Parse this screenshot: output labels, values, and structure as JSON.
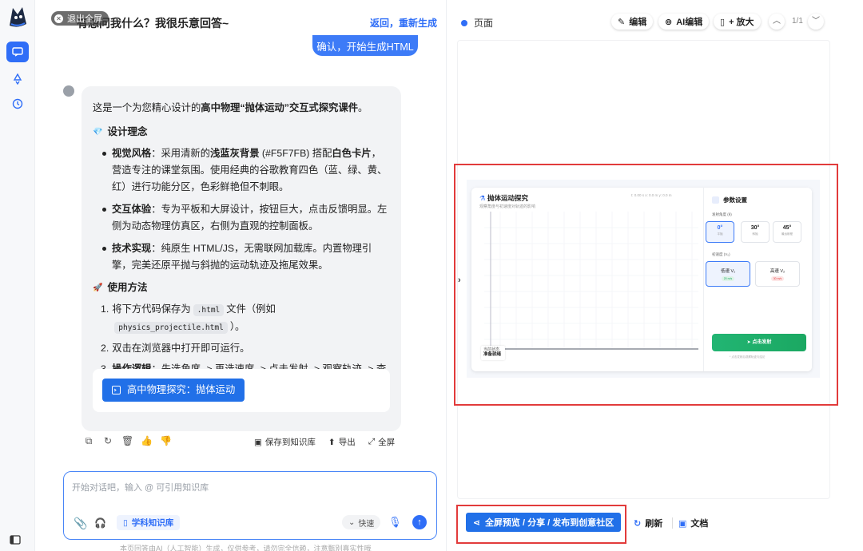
{
  "exit_fullscreen": "退出全屏",
  "chat": {
    "title": "有想问我什么？我很乐意回答~",
    "regenerate": "返回，重新生成",
    "user_message": "确认，开始生成HTML",
    "answer": {
      "intro_plain": "这是一个为您精心设计的",
      "intro_bold": "高中物理“抛体运动”交互式探究课件",
      "intro_end": "。",
      "design_heading": "设计理念",
      "design_icon": "💎",
      "bullets": [
        {
          "label": "视觉风格",
          "text_a": "：采用清新的",
          "bold_a": "浅蓝灰背景",
          "text_b": " (#F5F7FB) 搭配",
          "bold_b": "白色卡片",
          "text_c": "，营造专注的课堂氛围。使用经典的谷歌教育四色（蓝、绿、黄、红）进行功能分区，色彩鲜艳但不刺眼。"
        },
        {
          "label": "交互体验",
          "text": "：专为平板和大屏设计，按钮巨大，点击反馈明显。左侧为动态物理仿真区，右侧为直观的控制面板。"
        },
        {
          "label": "技术实现",
          "text": "：纯原生 HTML/JS，无需联网加载库。内置物理引擎，完美还原平抛与斜抛的运动轨迹及拖尾效果。"
        }
      ],
      "usage_heading": "使用方法",
      "usage_icon": "🚀",
      "steps": [
        {
          "num": "1.",
          "text_a": "将下方代码保存为",
          "code_a": ".html",
          "text_b": "文件（例如",
          "code_b": "physics_projectile.html",
          "text_c": "）。"
        },
        {
          "num": "2.",
          "text": "双击在浏览器中打开即可运行。"
        },
        {
          "num": "3.",
          "label": "操作逻辑",
          "text": "：先选角度 -> 再选速度 -> 点击发射 -> 观察轨迹 -> 查看结论。"
        }
      ],
      "artifact_label": "高中物理探究：抛体运动"
    },
    "actions": {
      "save_kb": "保存到知识库",
      "export": "导出",
      "fullscreen": "全屏"
    },
    "input": {
      "placeholder": "开始对话吧，输入 @ 可引用知识库",
      "kb_chip": "学科知识库",
      "speed": "快速"
    },
    "disclaimer": "本页回答由AI（人工智能）生成，仅供参考，请勿完全信赖，注意甄别真实性哦"
  },
  "preview_panel": {
    "title": "页面",
    "edit": "编辑",
    "ai_edit": "AI编辑",
    "zoom": "+ 放大",
    "page_count": "1/1",
    "app": {
      "title": "抛体运动探究",
      "subtitle": "观察角度与初速度对轨迹的影响",
      "meta": "t: 0.00 s   x: 0.0 m   y: 0.0 m",
      "status_label": "当前状态",
      "status_value": "准备就绪",
      "panel_title": "参数设置",
      "angle_label": "发射角度 (θ)",
      "angles": [
        {
          "value": "0°",
          "sub": "平抛",
          "selected": true
        },
        {
          "value": "30°",
          "sub": "斜抛",
          "selected": false
        },
        {
          "value": "45°",
          "sub": "最远射程",
          "selected": false
        }
      ],
      "speed_label": "初速度 (V₀)",
      "speeds": [
        {
          "name": "低速 V₁",
          "tag": "20 m/s",
          "selected": true
        },
        {
          "name": "高速 V₂",
          "tag": "30 m/s",
          "selected": false
        }
      ],
      "fire": "点击发射",
      "hint": "* 点击发射后观察轨迹与结论"
    },
    "bottom": {
      "share": "全屏预览 / 分享 / 发布到创意社区",
      "refresh": "刷新",
      "docs": "文档"
    }
  },
  "colors": {
    "accent": "#2f6ef7",
    "highlight": "#e23b3b",
    "fire": "#22b573"
  }
}
